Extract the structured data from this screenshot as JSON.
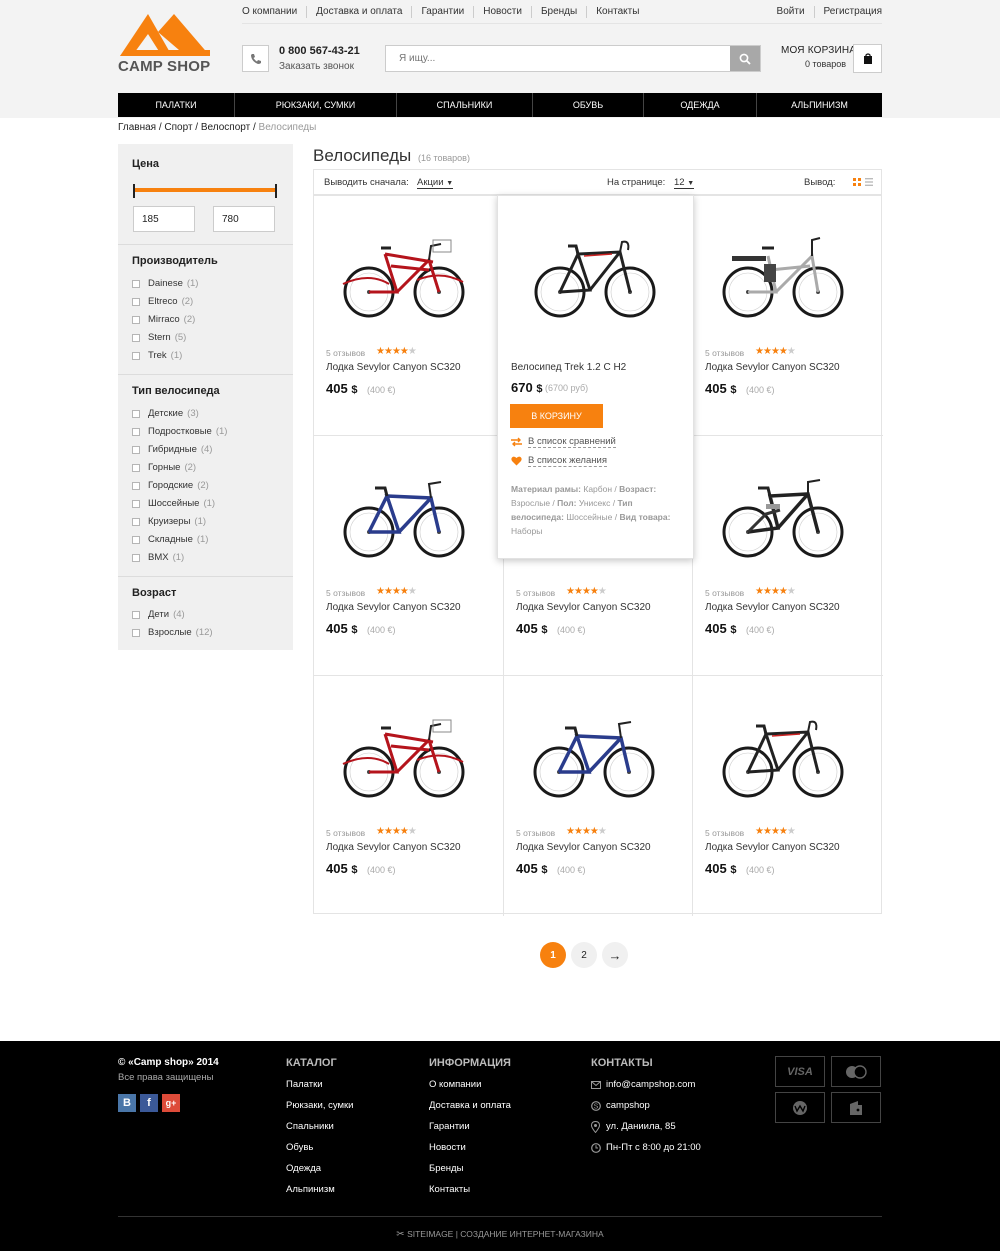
{
  "header": {
    "top_links": [
      "О компании",
      "Доставка и оплата",
      "Гарантии",
      "Новости",
      "Бренды",
      "Контакты"
    ],
    "login": "Войти",
    "register": "Регистрация",
    "logo_text": "CAMP SHOP",
    "phone": "0 800 567-43-21",
    "callback": "Заказать звонок",
    "search_placeholder": "Я ищу...",
    "cart_title": "МОЯ КОРЗИНА",
    "cart_count": "0 товаров",
    "accent": "#f7810f"
  },
  "nav": [
    "ПАЛАТКИ",
    "РЮКЗАКИ, СУМКИ",
    "СПАЛЬНИКИ",
    "ОБУВЬ",
    "ОДЕЖДА",
    "АЛЬПИНИЗМ"
  ],
  "breadcrumb": [
    "Главная",
    "Спорт",
    "Велоспорт",
    "Велосипеды"
  ],
  "filters": {
    "price": {
      "title": "Цена",
      "min": "185",
      "max": "780"
    },
    "brand": {
      "title": "Производитель",
      "items": [
        {
          "label": "Dainese",
          "count": "(1)"
        },
        {
          "label": "Eltreco",
          "count": "(2)"
        },
        {
          "label": "Mirraco",
          "count": "(2)"
        },
        {
          "label": "Stern",
          "count": "(5)"
        },
        {
          "label": "Trek",
          "count": "(1)"
        }
      ]
    },
    "type": {
      "title": "Тип велосипеда",
      "items": [
        {
          "label": "Детские",
          "count": "(3)"
        },
        {
          "label": "Подростковые",
          "count": "(1)"
        },
        {
          "label": "Гибридные",
          "count": "(4)"
        },
        {
          "label": "Горные",
          "count": "(2)"
        },
        {
          "label": "Городские",
          "count": "(2)"
        },
        {
          "label": "Шоссейные",
          "count": "(1)"
        },
        {
          "label": "Круизеры",
          "count": "(1)"
        },
        {
          "label": "Складные",
          "count": "(1)"
        },
        {
          "label": "BMX",
          "count": "(1)"
        }
      ]
    },
    "age": {
      "title": "Возраст",
      "items": [
        {
          "label": "Дети",
          "count": "(4)"
        },
        {
          "label": "Взрослые",
          "count": "(12)"
        }
      ]
    }
  },
  "catalog": {
    "title": "Велосипеды",
    "count": "(16 товаров)",
    "sort_label": "Выводить сначала:",
    "sort_value": "Акции",
    "per_page_label": "На странице:",
    "per_page_value": "12",
    "view_label": "Вывод:"
  },
  "product": {
    "reviews": "5 отзывов",
    "name": "Лодка Sevylor Canyon SC320",
    "price": "405",
    "currency": "$",
    "old_price": "(400 €)",
    "rating": 4,
    "rating_max": 5
  },
  "products": [
    {
      "bike": "red-cruiser"
    },
    {
      "bike": "black-road"
    },
    {
      "bike": "ebike"
    },
    {
      "bike": "blue-mtb"
    },
    {
      "bike": "blue-mtb"
    },
    {
      "bike": "black-suspension"
    },
    {
      "bike": "red-cruiser"
    },
    {
      "bike": "blue-mtb"
    },
    {
      "bike": "black-road"
    }
  ],
  "popup": {
    "name": "Велосипед Trek 1.2 C H2",
    "price": "670",
    "currency": "$",
    "old_price": "(6700 руб)",
    "buy": "В КОРЗИНУ",
    "compare": "В список сравнений",
    "wishlist": "В список желания",
    "specs_1_label": "Материал рамы:",
    "specs_1_value": " Карбон / ",
    "specs_2_label": "Возраст:",
    "specs_2_value": " Взрослые / ",
    "specs_3_label": "Пол:",
    "specs_3_value": " Унисекс / ",
    "specs_4_label": "Тип велосипеда:",
    "specs_4_value": " Шоссейные / ",
    "specs_5_label": "Вид товара:",
    "specs_5_value": " Наборы"
  },
  "pagination": {
    "pages": [
      "1",
      "2"
    ],
    "next": "→",
    "current": "1"
  },
  "footer": {
    "copyright": "© «Camp shop» 2014",
    "rights": "Все права защищены",
    "social": [
      "В",
      "f",
      "g+"
    ],
    "catalog_title": "КАТАЛОГ",
    "catalog": [
      "Палатки",
      "Рюкзаки, сумки",
      "Спальники",
      "Обувь",
      "Одежда",
      "Альпинизм"
    ],
    "info_title": "ИНФОРМАЦИЯ",
    "info": [
      "О компании",
      "Доставка и оплата",
      "Гарантии",
      "Новости",
      "Бренды",
      "Контакты"
    ],
    "contacts_title": "КОНТАКТЫ",
    "email": "info@campshop.com",
    "skype": "campshop",
    "address": "ул. Даниила, 85",
    "hours": "Пн-Пт с 8:00 до 21:00",
    "payments": [
      "VISA",
      "mastercard",
      "webmoney",
      "yandex-money"
    ],
    "credit": "SITEIMAGE | СОЗДАНИЕ ИНТЕРНЕТ-МАГАЗИНА"
  }
}
